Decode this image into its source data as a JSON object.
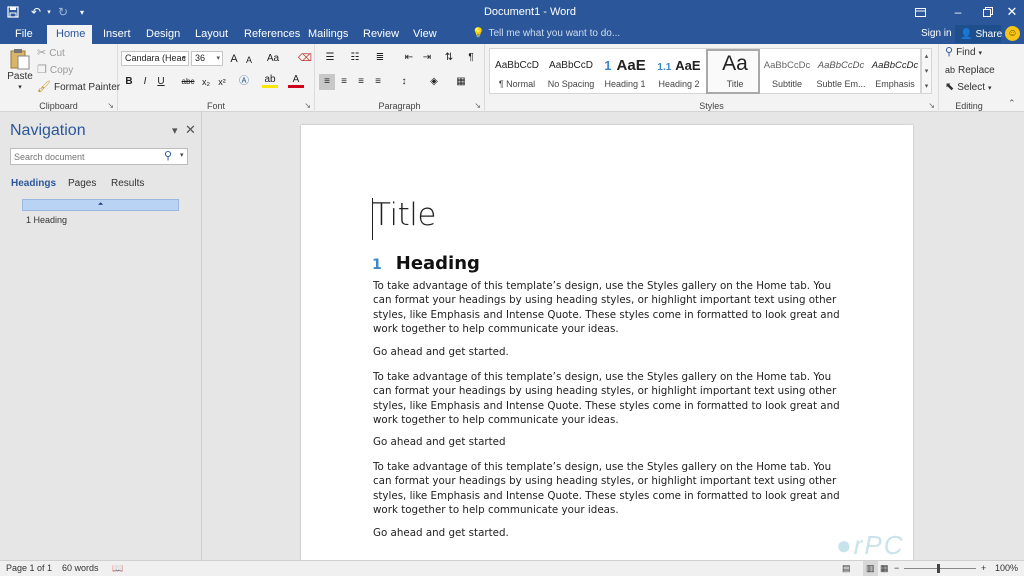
{
  "window": {
    "title": "Document1 - Word",
    "save_icon": "save-icon",
    "undo_icon": "undo-icon",
    "redo_icon": "redo-icon",
    "minimize_icon": "minimize-icon",
    "restore_icon": "restore-icon",
    "close_icon": "close-icon",
    "ribbon_display_icon": "ribbon-display-options-icon"
  },
  "tabs": [
    {
      "label": "File"
    },
    {
      "label": "Home"
    },
    {
      "label": "Insert"
    },
    {
      "label": "Design"
    },
    {
      "label": "Layout"
    },
    {
      "label": "References"
    },
    {
      "label": "Mailings"
    },
    {
      "label": "Review"
    },
    {
      "label": "View"
    }
  ],
  "active_tab": "Home",
  "tell_me": "Tell me what you want to do...",
  "account": {
    "sign_in": "Sign in",
    "share": "Share"
  },
  "ribbon": {
    "clipboard": {
      "label": "Clipboard",
      "paste": "Paste",
      "cut": "Cut",
      "copy": "Copy",
      "format_painter": "Format Painter"
    },
    "font": {
      "label": "Font",
      "font_name": "Candara (Heac",
      "font_size": "36",
      "bold": "B",
      "italic": "I",
      "underline": "U",
      "strike": "abc",
      "subscript": "x₂",
      "superscript": "x²",
      "grow": "A",
      "shrink": "A",
      "case": "Aa"
    },
    "paragraph": {
      "label": "Paragraph",
      "pilcrow": "¶"
    },
    "styles": {
      "label": "Styles",
      "items": [
        {
          "preview": "AaBbCcD",
          "name": "¶ Normal"
        },
        {
          "preview": "AaBbCcD",
          "name": "No Spacing"
        },
        {
          "preview": "AaE",
          "name": "Heading 1",
          "prefix": "1"
        },
        {
          "preview": "AaE",
          "name": "Heading 2",
          "prefix": "1.1"
        },
        {
          "preview": "Aa",
          "name": "Title"
        },
        {
          "preview": "AaBbCcDc",
          "name": "Subtitle"
        },
        {
          "preview": "AaBbCcDc",
          "name": "Subtle Em..."
        },
        {
          "preview": "AaBbCcDc",
          "name": "Emphasis"
        }
      ],
      "selected": "Title"
    },
    "editing": {
      "label": "Editing",
      "find": "Find",
      "replace": "Replace",
      "select": "Select"
    }
  },
  "navigation": {
    "title": "Navigation",
    "search_placeholder": "Search document",
    "tabs": [
      "Headings",
      "Pages",
      "Results"
    ],
    "active_tab": "Headings",
    "headings": [
      "1 Heading"
    ]
  },
  "document": {
    "title": "Title",
    "heading_number": "1",
    "heading": "Heading",
    "paragraphs": [
      "To take advantage of this template’s design, use the Styles gallery on the Home tab. You can format your headings by using heading styles, or highlight important text using other styles, like Emphasis and Intense Quote. These styles come in formatted to look great and work together to help communicate your ideas.",
      "Go ahead and get started.",
      "To take advantage of this template’s design, use the Styles gallery on the Home tab. You can format your headings by using heading styles, or highlight important text using other styles, like Emphasis and Intense Quote. These styles come in formatted to look great and work together to help communicate your ideas.",
      "Go ahead and get started",
      "To take advantage of this template’s design, use the Styles gallery on the Home tab. You can format your headings by using heading styles, or highlight important text using other styles, like Emphasis and Intense Quote. These styles come in formatted to look great and work together to help communicate your ideas.",
      "Go ahead and get started."
    ]
  },
  "status": {
    "page": "Page 1 of 1",
    "words": "60 words",
    "zoom": "100%",
    "zoom_out": "−",
    "zoom_in": "+"
  },
  "colors": {
    "accent": "#2b579a",
    "heading_number": "#3a88c8"
  }
}
